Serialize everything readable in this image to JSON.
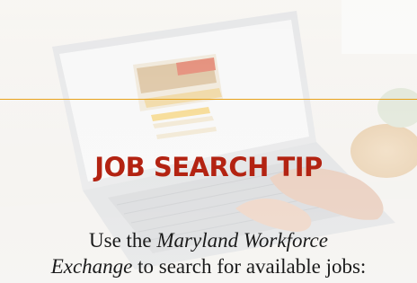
{
  "slide": {
    "title": "JOB SEARCH TIP",
    "body": {
      "line1_prefix": "Use the ",
      "line1_italic": "Maryland Workforce",
      "line2_italic": "Exchange",
      "line2_suffix": " to search for available jobs:"
    }
  },
  "colors": {
    "title": "#b32312",
    "rule": "#e8a21a",
    "body_text": "#1a1a1a"
  },
  "background": {
    "image": "laptop-photo",
    "laptop_screen_icon": "web-page-icon"
  }
}
